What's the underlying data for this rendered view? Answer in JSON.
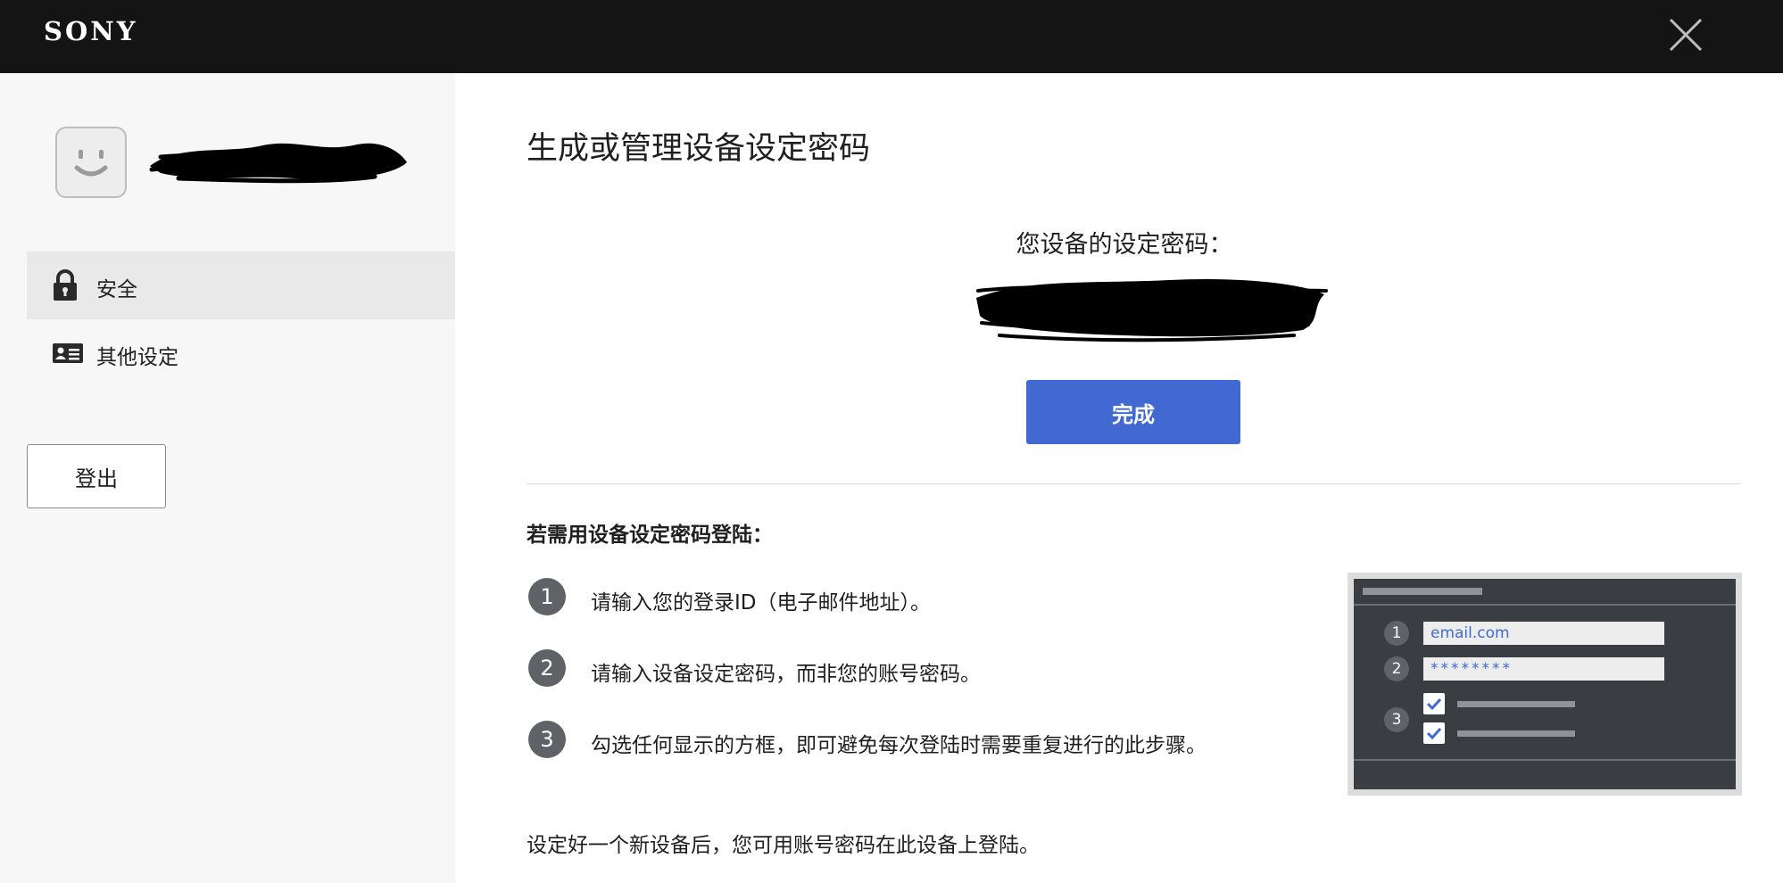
{
  "header": {
    "logo": "SONY",
    "close_icon": "close-icon"
  },
  "sidebar": {
    "avatar_icon": "smiley-face-icon",
    "items": [
      {
        "label": "安全",
        "icon": "lock-icon",
        "active": true
      },
      {
        "label": "其他设定",
        "icon": "id-card-icon",
        "active": false
      }
    ],
    "logout_label": "登出"
  },
  "main": {
    "title": "生成或管理设备设定密码",
    "password_label": "您设备的设定密码：",
    "done_label": "完成",
    "instructions_heading": "若需用设备设定密码登陆：",
    "steps": [
      {
        "num": "1",
        "text": "请输入您的登录ID（电子邮件地址）。"
      },
      {
        "num": "2",
        "text": "请输入设备设定密码，而非您的账号密码。"
      },
      {
        "num": "3",
        "text": "勾选任何显示的方框，即可避免每次登陆时需要重复进行的此步骤。"
      }
    ],
    "footer_note": "设定好一个新设备后，您可用账号密码在此设备上登陆。"
  },
  "illustration": {
    "nums": [
      "1",
      "2",
      "3"
    ],
    "email_value": "email.com",
    "password_value": "********",
    "check_icon": "checkmark-icon"
  },
  "colors": {
    "topbar": "#141414",
    "accent": "#4169d1",
    "sidebar_bg": "#f7f7f7",
    "step_circle": "#5f6368"
  }
}
